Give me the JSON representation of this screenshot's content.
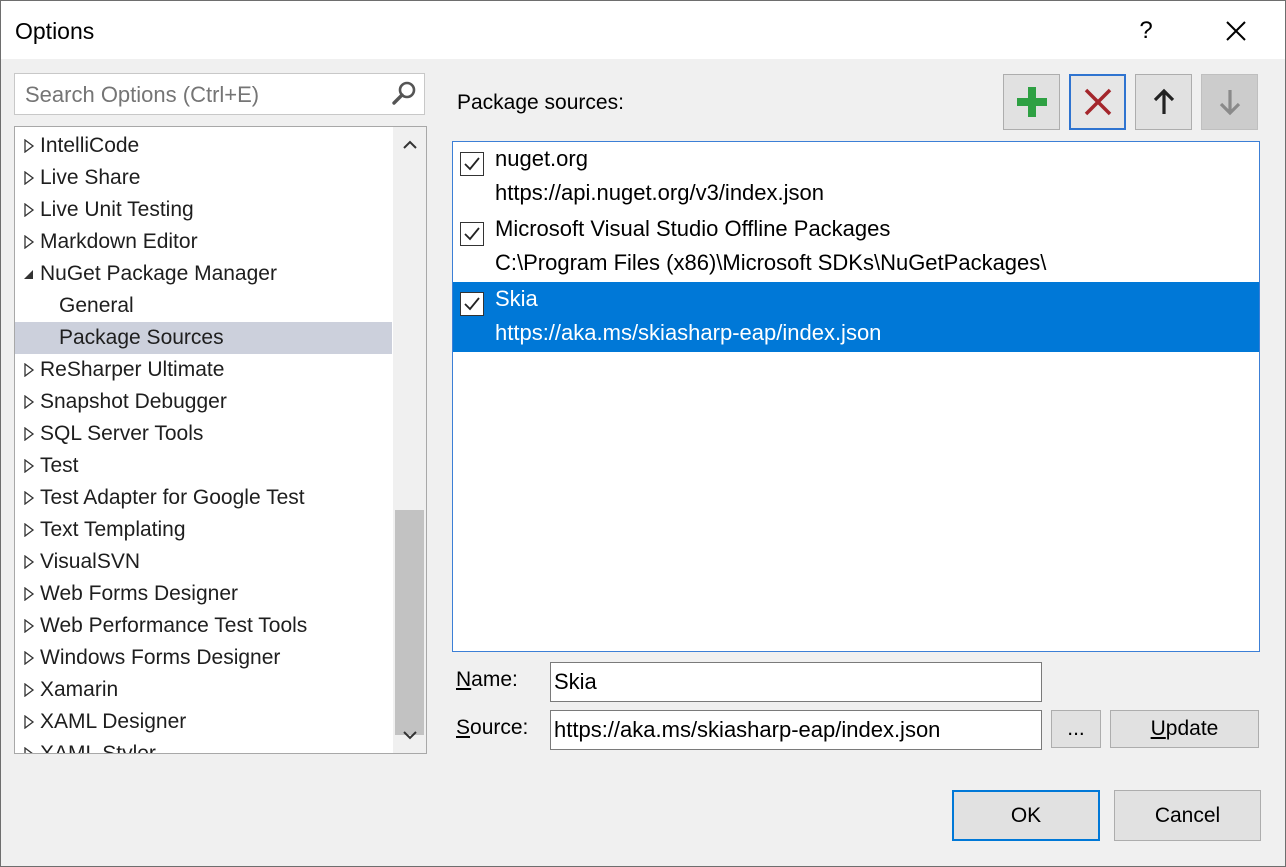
{
  "window": {
    "title": "Options",
    "help_glyph": "?",
    "close_glyph": "✕"
  },
  "search": {
    "placeholder": "Search Options (Ctrl+E)"
  },
  "tree": {
    "items": [
      {
        "label": "IntelliCode",
        "expanded": false,
        "level": 0
      },
      {
        "label": "Live Share",
        "expanded": false,
        "level": 0
      },
      {
        "label": "Live Unit Testing",
        "expanded": false,
        "level": 0
      },
      {
        "label": "Markdown Editor",
        "expanded": false,
        "level": 0
      },
      {
        "label": "NuGet Package Manager",
        "expanded": true,
        "level": 0
      },
      {
        "label": "General",
        "level": 1
      },
      {
        "label": "Package Sources",
        "level": 1,
        "selected": true
      },
      {
        "label": "ReSharper Ultimate",
        "expanded": false,
        "level": 0
      },
      {
        "label": "Snapshot Debugger",
        "expanded": false,
        "level": 0
      },
      {
        "label": "SQL Server Tools",
        "expanded": false,
        "level": 0
      },
      {
        "label": "Test",
        "expanded": false,
        "level": 0
      },
      {
        "label": "Test Adapter for Google Test",
        "expanded": false,
        "level": 0
      },
      {
        "label": "Text Templating",
        "expanded": false,
        "level": 0
      },
      {
        "label": "VisualSVN",
        "expanded": false,
        "level": 0
      },
      {
        "label": "Web Forms Designer",
        "expanded": false,
        "level": 0
      },
      {
        "label": "Web Performance Test Tools",
        "expanded": false,
        "level": 0
      },
      {
        "label": "Windows Forms Designer",
        "expanded": false,
        "level": 0
      },
      {
        "label": "Xamarin",
        "expanded": false,
        "level": 0
      },
      {
        "label": "XAML Designer",
        "expanded": false,
        "level": 0
      },
      {
        "label": "XAML Styler",
        "expanded": false,
        "level": 0
      }
    ]
  },
  "sources_panel": {
    "label": "Package sources:",
    "sources": [
      {
        "name": "nuget.org",
        "url": "https://api.nuget.org/v3/index.json",
        "checked": true,
        "selected": false
      },
      {
        "name": "Microsoft Visual Studio Offline Packages",
        "url": "C:\\Program Files (x86)\\Microsoft SDKs\\NuGetPackages\\",
        "checked": true,
        "selected": false
      },
      {
        "name": "Skia",
        "url": "https://aka.ms/skiasharp-eap/index.json",
        "checked": true,
        "selected": true
      }
    ]
  },
  "form": {
    "name_label_mnemonic": "N",
    "name_label_rest": "ame:",
    "name_value": "Skia",
    "source_label_mnemonic": "S",
    "source_label_rest": "ource:",
    "source_value": "https://aka.ms/skiasharp-eap/index.json",
    "browse_label": "...",
    "update_mnemonic": "U",
    "update_rest": "pdate"
  },
  "footer": {
    "ok_label": "OK",
    "cancel_label": "Cancel"
  },
  "colors": {
    "selection": "#0078d7",
    "tree_selection": "#ccd0dc",
    "add_green": "#2ea043",
    "remove_red": "#a4262c"
  }
}
